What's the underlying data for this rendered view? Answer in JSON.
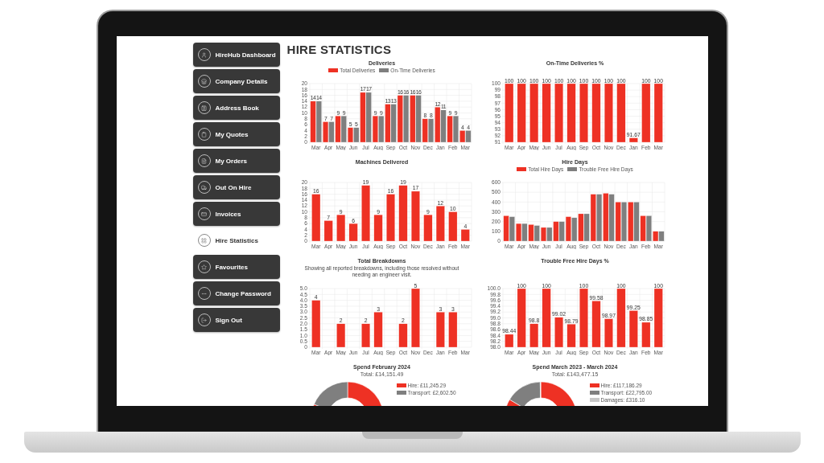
{
  "sidebar": {
    "items": [
      {
        "label": "HireHub Dashboard",
        "selected": false
      },
      {
        "label": "Company Details",
        "selected": false
      },
      {
        "label": "Address Book",
        "selected": false
      },
      {
        "label": "My Quotes",
        "selected": false
      },
      {
        "label": "My Orders",
        "selected": false
      },
      {
        "label": "Out On Hire",
        "selected": false
      },
      {
        "label": "Invoices",
        "selected": false
      },
      {
        "label": "Hire Statistics",
        "selected": true
      },
      {
        "label": "Favourites",
        "selected": false
      },
      {
        "label": "Change Password",
        "selected": false
      },
      {
        "label": "Sign Out",
        "selected": false
      }
    ]
  },
  "page_title": "HIRE STATISTICS",
  "charts": [
    {
      "chart_data": {
        "type": "bar",
        "title": "Deliveries",
        "categories": [
          "Mar",
          "Apr",
          "May",
          "Jun",
          "Jul",
          "Aug",
          "Sep",
          "Oct",
          "Nov",
          "Dec",
          "Jan",
          "Feb",
          "Mar"
        ],
        "ylim": [
          0,
          20
        ],
        "yticks": [
          0,
          2,
          4,
          6,
          8,
          10,
          12,
          14,
          16,
          18,
          20
        ],
        "grid": true,
        "data_labels": true,
        "series": [
          {
            "name": "Total Deliveries",
            "color": "#ee3124",
            "values": [
              14,
              7,
              9,
              5,
              17,
              9,
              13,
              16,
              16,
              8,
              12,
              9,
              4
            ]
          },
          {
            "name": "On-Time Deliveries",
            "color": "#7f7f7f",
            "values": [
              14,
              7,
              9,
              5,
              17,
              9,
              13,
              16,
              16,
              8,
              11,
              9,
              4
            ]
          }
        ]
      }
    },
    {
      "chart_data": {
        "type": "bar",
        "title": "On-Time Deliveries %",
        "categories": [
          "Mar",
          "Apr",
          "May",
          "Jun",
          "Jul",
          "Aug",
          "Sep",
          "Oct",
          "Nov",
          "Dec",
          "Jan",
          "Feb",
          "Mar"
        ],
        "ylim": [
          91,
          100
        ],
        "yticks": [
          91,
          92,
          93,
          94,
          95,
          96,
          97,
          98,
          99,
          100
        ],
        "grid": true,
        "data_labels": true,
        "series": [
          {
            "color": "#ee3124",
            "values": [
              100,
              100,
              100,
              100,
              100,
              100,
              100,
              100,
              100,
              100,
              91.67,
              100,
              100
            ]
          }
        ]
      }
    },
    {
      "chart_data": {
        "type": "bar",
        "title": "Machines Delivered",
        "categories": [
          "Mar",
          "Apr",
          "May",
          "Jun",
          "Jul",
          "Aug",
          "Sep",
          "Oct",
          "Nov",
          "Dec",
          "Jan",
          "Feb",
          "Mar"
        ],
        "ylim": [
          0,
          20
        ],
        "yticks": [
          0,
          2,
          4,
          6,
          8,
          10,
          12,
          14,
          16,
          18,
          20
        ],
        "grid": true,
        "data_labels": true,
        "series": [
          {
            "color": "#ee3124",
            "values": [
              16,
              7,
              9,
              6,
              19,
              9,
              16,
              19,
              17,
              9,
              12,
              10,
              4
            ]
          }
        ]
      }
    },
    {
      "chart_data": {
        "type": "bar",
        "title": "Hire Days",
        "categories": [
          "Mar",
          "Apr",
          "May",
          "Jun",
          "Jul",
          "Aug",
          "Sep",
          "Oct",
          "Nov",
          "Dec",
          "Jan",
          "Feb",
          "Mar"
        ],
        "ylim": [
          0,
          600
        ],
        "yticks": [
          0,
          100,
          200,
          300,
          400,
          500,
          600
        ],
        "grid": true,
        "series": [
          {
            "name": "Total Hire Days",
            "color": "#ee3124",
            "values": [
              260,
              180,
              170,
              140,
              200,
              250,
              280,
              480,
              490,
              400,
              400,
              260,
              100
            ]
          },
          {
            "name": "Trouble Free Hire Days",
            "color": "#7f7f7f",
            "values": [
              250,
              180,
              160,
              140,
              200,
              240,
              280,
              480,
              480,
              400,
              400,
              260,
              100
            ]
          }
        ]
      }
    },
    {
      "subtitle": "Showing all reported breakdowns, including those resolved without needing an engineer visit.",
      "chart_data": {
        "type": "bar",
        "title": "Total Breakdowns",
        "categories": [
          "Mar",
          "Apr",
          "May",
          "Jun",
          "Jul",
          "Aug",
          "Sep",
          "Oct",
          "Nov",
          "Dec",
          "Jan",
          "Feb",
          "Mar"
        ],
        "ylim": [
          0,
          5
        ],
        "yticks": [
          {
            "value": 0,
            "label": "0"
          },
          {
            "value": 0.5,
            "label": "0.5"
          },
          {
            "value": 1,
            "label": "1.0"
          },
          {
            "value": 1.5,
            "label": "1.5"
          },
          {
            "value": 2,
            "label": "2.0"
          },
          {
            "value": 2.5,
            "label": "2.5"
          },
          {
            "value": 3,
            "label": "3.0"
          },
          {
            "value": 3.5,
            "label": "3.5"
          },
          {
            "value": 4,
            "label": "4.0"
          },
          {
            "value": 4.5,
            "label": "4.5"
          },
          {
            "value": 5,
            "label": "5.0"
          }
        ],
        "grid": true,
        "data_labels": true,
        "series": [
          {
            "color": "#ee3124",
            "values": [
              4,
              null,
              2,
              null,
              2,
              3,
              null,
              2,
              5,
              null,
              3,
              3,
              null
            ]
          }
        ]
      }
    },
    {
      "chart_data": {
        "type": "bar",
        "title": "Trouble Free Hire Days %",
        "categories": [
          "Mar",
          "Apr",
          "May",
          "Jun",
          "Jul",
          "Aug",
          "Sep",
          "Oct",
          "Nov",
          "Dec",
          "Jan",
          "Feb",
          "Mar"
        ],
        "ylim": [
          98,
          100
        ],
        "yticks": [
          {
            "value": 98,
            "label": "98.0"
          },
          {
            "value": 98.2,
            "label": "98.2"
          },
          {
            "value": 98.4,
            "label": "98.4"
          },
          {
            "value": 98.6,
            "label": "98.6"
          },
          {
            "value": 98.8,
            "label": "98.8"
          },
          {
            "value": 99,
            "label": "99.0"
          },
          {
            "value": 99.2,
            "label": "99.2"
          },
          {
            "value": 99.4,
            "label": "99.4"
          },
          {
            "value": 99.6,
            "label": "99.6"
          },
          {
            "value": 99.8,
            "label": "99.8"
          },
          {
            "value": 100,
            "label": "100.0"
          }
        ],
        "grid": true,
        "data_labels": true,
        "series": [
          {
            "color": "#ee3124",
            "values": [
              98.44,
              100,
              98.8,
              100,
              99.02,
              98.79,
              100,
              99.58,
              98.97,
              100,
              99.25,
              98.85,
              100
            ]
          }
        ]
      }
    }
  ],
  "spend_charts": [
    {
      "total": "Total: £14,151.49",
      "chart_data": {
        "type": "donut",
        "title": "Spend February 2024",
        "categories": [
          "Hire: £11,245.29",
          "Transport: £2,602.50"
        ],
        "values": [
          11245.29,
          2602.5
        ]
      }
    },
    {
      "total": "Total: £143,477.15",
      "chart_data": {
        "type": "donut",
        "title": "Spend March 2023 - March 2024",
        "categories": [
          "Hire: £117,186.29",
          "Transport: £22,795.00",
          "Damages: £316.10"
        ],
        "values": [
          117186.29,
          22795,
          316.1
        ]
      }
    }
  ]
}
